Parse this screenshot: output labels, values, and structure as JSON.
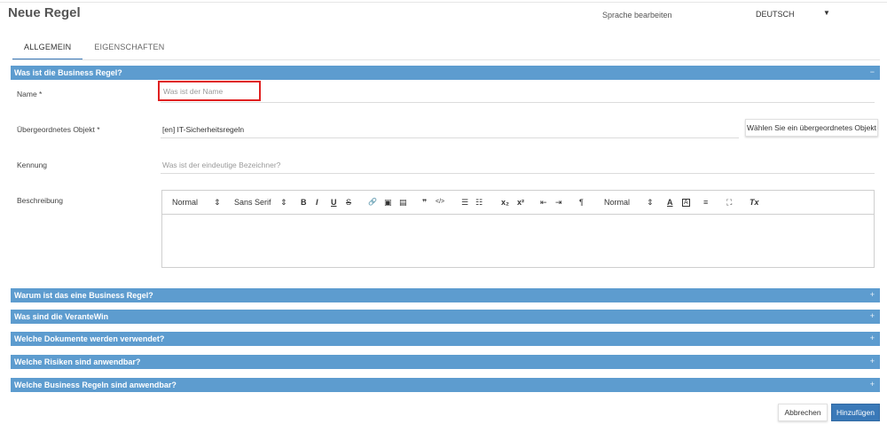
{
  "page": {
    "title": "Neue Regel"
  },
  "language": {
    "label": "Sprache bearbeiten",
    "selected": "DEUTSCH"
  },
  "tabs": [
    {
      "label": "ALLGEMEIN",
      "active": true
    },
    {
      "label": "EIGENSCHAFTEN",
      "active": false
    }
  ],
  "sections": {
    "general": {
      "title": "Was ist die Business Regel?",
      "toggle": "−"
    },
    "collapsed": [
      {
        "title": "Warum ist das eine Business Regel?",
        "toggle": "+"
      },
      {
        "title": "Was sind die VeranteWin",
        "toggle": "+"
      },
      {
        "title": "Welche Dokumente werden verwendet?",
        "toggle": "+"
      },
      {
        "title": "Welche Risiken sind anwendbar?",
        "toggle": "+"
      },
      {
        "title": "Welche Business Regeln sind anwendbar?",
        "toggle": "+"
      }
    ]
  },
  "fields": {
    "name": {
      "label": "Name *",
      "placeholder": "Was ist der Name"
    },
    "parent": {
      "label": "Übergeordnetes Objekt  *",
      "value": "[en] IT-Sicherheitsregeln",
      "button": "Wählen Sie ein übergeordnetes Objekt"
    },
    "identifier": {
      "label": "Kennung",
      "placeholder": "Was ist der eindeutige Bezeichner?"
    },
    "description": {
      "label": "Beschreibung"
    }
  },
  "editor": {
    "toolbar": {
      "header_select": "Normal",
      "font_select": "Sans Serif",
      "bold": "B",
      "italic": "I",
      "underline": "U",
      "strike": "S",
      "size_select": "Normal",
      "select_caret": "⇕",
      "link": "🔗",
      "image": "▣",
      "video": "▤",
      "blockquote": "❞",
      "code": "</>",
      "ordered_list": "☰",
      "bullet_list": "☷",
      "subscript": "x₂",
      "superscript": "x²",
      "outdent": "⇤",
      "indent": "⇥",
      "direction": "¶",
      "color": "A",
      "background": "A",
      "align": "≡",
      "fullscreen": "⛶",
      "clean": "Tx"
    }
  },
  "actions": {
    "cancel": "Abbrechen",
    "add": "Hinzufügen"
  },
  "colors": {
    "accent": "#3a79b8",
    "section_bar": "#5d9ccf",
    "highlight": "#e02020"
  }
}
